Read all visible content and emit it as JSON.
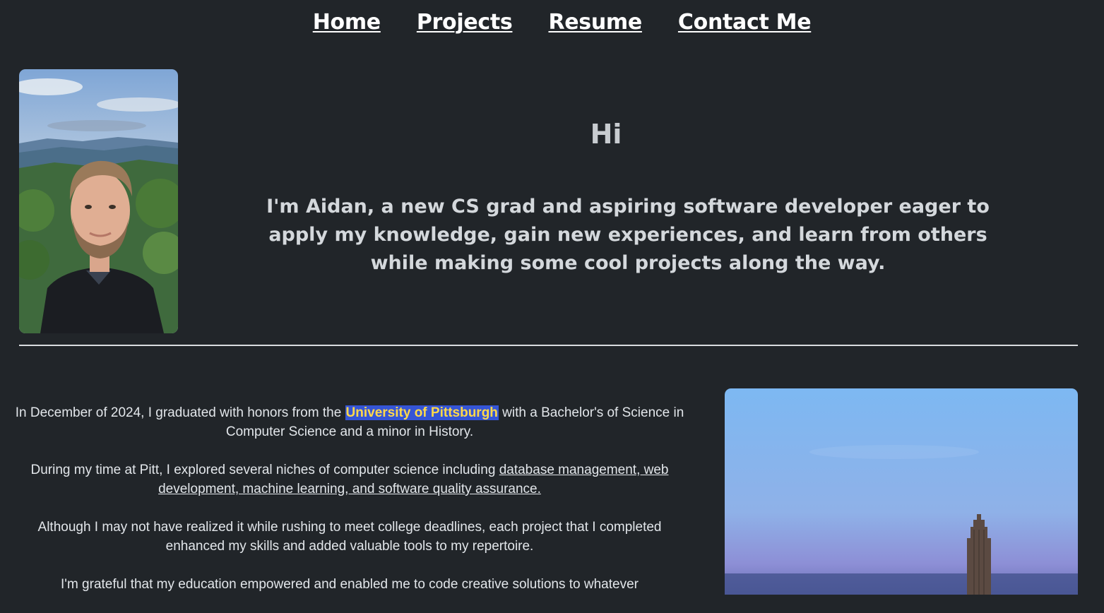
{
  "nav": {
    "items": [
      "Home",
      "Projects",
      "Resume",
      "Contact Me"
    ]
  },
  "hero": {
    "greeting": "Hi",
    "intro": "I'm Aidan, a new CS grad and aspiring software developer eager to apply my knowledge, gain new experiences, and learn from others while making some cool projects along the way."
  },
  "about": {
    "p1_before": "In December of 2024, I graduated with honors from the ",
    "p1_link": "University of Pittsburgh",
    "p1_after": " with a Bachelor's of Science in Computer Science and a minor in History.",
    "p2_before": "During my time at Pitt, I explored several niches of computer science including ",
    "p2_link": "database management, web development, machine learning, and software quality assurance.",
    "p3": "Although I may not have realized it while rushing to meet college deadlines, each project that I completed enhanced my skills and added valuable tools to my repertoire.",
    "p4": "I'm grateful that my education empowered and enabled me to code creative solutions to whatever"
  },
  "colors": {
    "background": "#212529",
    "highlight_bg": "#3555d6",
    "highlight_text": "#ffd84a"
  },
  "images": {
    "portrait": "portrait-photo",
    "campus": "cathedral-of-learning-photo"
  }
}
